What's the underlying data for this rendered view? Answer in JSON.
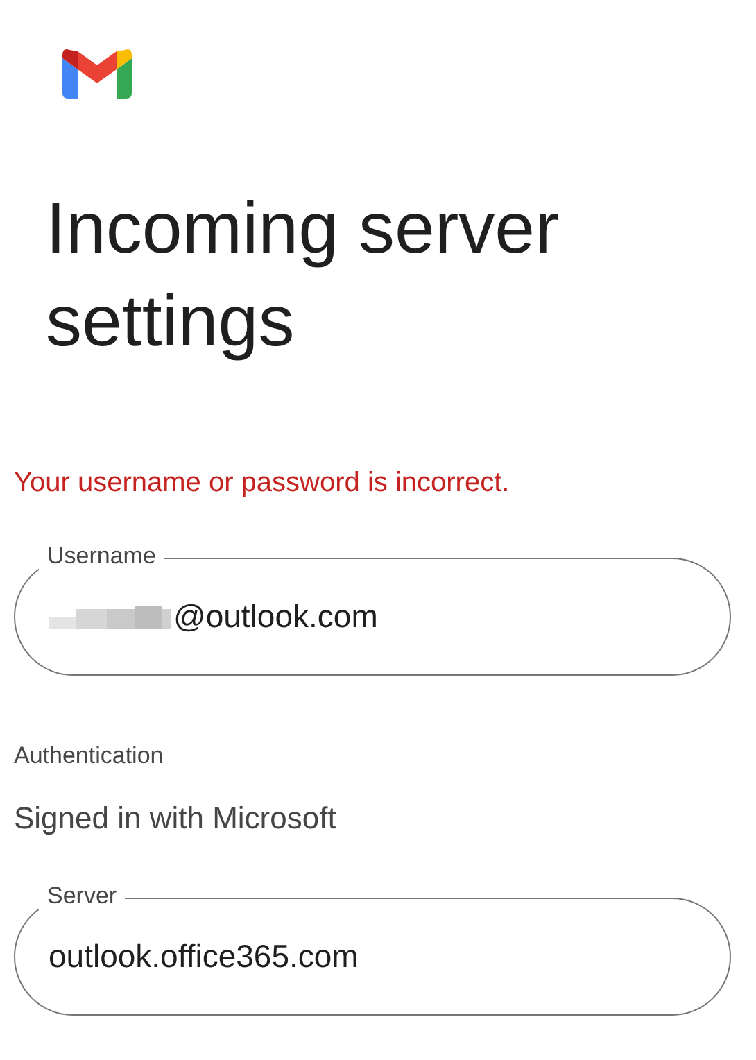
{
  "heading": "Incoming server settings",
  "error": "Your username or password is incorrect.",
  "username_field": {
    "label": "Username",
    "value": "@outlook.com",
    "redacted": true
  },
  "authentication": {
    "label": "Authentication",
    "value": "Signed in with Microsoft"
  },
  "server_field": {
    "label": "Server",
    "value": "outlook.office365.com"
  }
}
